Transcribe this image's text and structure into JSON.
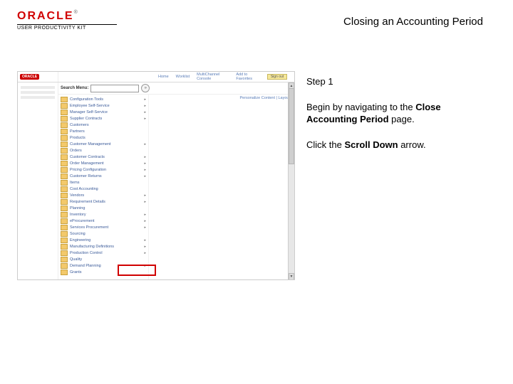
{
  "brand": {
    "name": "ORACLE",
    "trademark": "®",
    "product": "USER PRODUCTIVITY KIT"
  },
  "title": "Closing an Accounting Period",
  "step": {
    "label": "Step 1",
    "intro_prefix": "Begin by navigating to the ",
    "intro_bold": "Close Accounting Period",
    "intro_suffix": " page.",
    "action_prefix": "Click the ",
    "action_bold": "Scroll Down",
    "action_suffix": " arrow."
  },
  "oracle_mini": "ORACLE",
  "top_links": [
    "Home",
    "Worklist",
    "MultiChannel Console",
    "Add to Favorites"
  ],
  "logout": "Sign out",
  "search_label": "Search Menu:",
  "personalize": "Personalize Content | Layout",
  "menu_items": [
    {
      "label": "Configuration Tools",
      "arrow": true
    },
    {
      "label": "Employee Self-Service",
      "arrow": true
    },
    {
      "label": "Manager Self-Service",
      "arrow": true
    },
    {
      "label": "Supplier Contracts",
      "arrow": true
    },
    {
      "label": "Customers",
      "arrow": false
    },
    {
      "label": "Partners",
      "arrow": false
    },
    {
      "label": "Products",
      "arrow": false
    },
    {
      "label": "Customer Management",
      "arrow": true
    },
    {
      "label": "Orders",
      "arrow": false
    },
    {
      "label": "Customer Contracts",
      "arrow": true
    },
    {
      "label": "Order Management",
      "arrow": true
    },
    {
      "label": "Pricing Configuration",
      "arrow": true
    },
    {
      "label": "Customer Returns",
      "arrow": true
    },
    {
      "label": "Items",
      "arrow": false
    },
    {
      "label": "Cost Accounting",
      "arrow": false
    },
    {
      "label": "Vendors",
      "arrow": true
    },
    {
      "label": "Requirement Details",
      "arrow": true
    },
    {
      "label": "Planning",
      "arrow": false
    },
    {
      "label": "Inventory",
      "arrow": true
    },
    {
      "label": "eProcurement",
      "arrow": true
    },
    {
      "label": "Services Procurement",
      "arrow": true
    },
    {
      "label": "Sourcing",
      "arrow": false
    },
    {
      "label": "Engineering",
      "arrow": true
    },
    {
      "label": "Manufacturing Definitions",
      "arrow": true
    },
    {
      "label": "Production Control",
      "arrow": true
    },
    {
      "label": "Quality",
      "arrow": false
    },
    {
      "label": "Demand Planning",
      "arrow": true
    },
    {
      "label": "Grants",
      "arrow": false
    }
  ],
  "scroll": {
    "up": "▲",
    "down": "▼"
  }
}
